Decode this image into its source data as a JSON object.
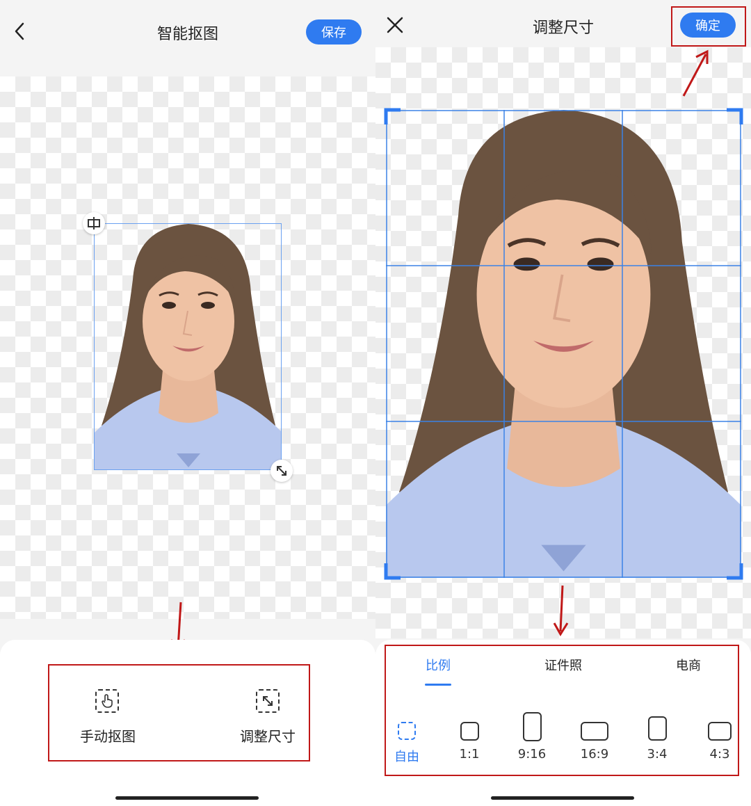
{
  "left": {
    "header": {
      "title": "智能抠图",
      "save_label": "保存",
      "back_icon": "chevron-left-icon"
    },
    "tools": [
      {
        "label": "手动抠图",
        "icon": "hand-select-icon"
      },
      {
        "label": "调整尺寸",
        "icon": "resize-icon"
      }
    ]
  },
  "right": {
    "header": {
      "title": "调整尺寸",
      "confirm_label": "确定",
      "close_icon": "close-icon"
    },
    "tabs": [
      {
        "label": "比例",
        "active": true
      },
      {
        "label": "证件照",
        "active": false
      },
      {
        "label": "电商",
        "active": false
      }
    ],
    "ratios": [
      {
        "label": "自由",
        "selected": true
      },
      {
        "label": "1:1",
        "selected": false
      },
      {
        "label": "9:16",
        "selected": false
      },
      {
        "label": "16:9",
        "selected": false
      },
      {
        "label": "3:4",
        "selected": false
      },
      {
        "label": "4:3",
        "selected": false
      }
    ]
  },
  "colors": {
    "accent": "#2f7bf0",
    "annotation_red": "#c01818",
    "selection_blue": "#6aa0f0"
  }
}
